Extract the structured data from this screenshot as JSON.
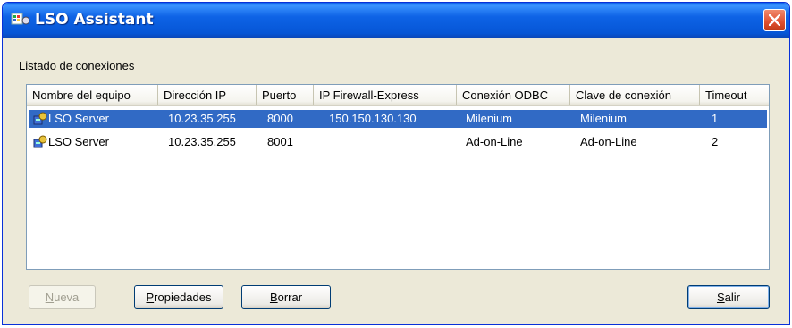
{
  "window": {
    "title": "LSO Assistant",
    "icon": "lso-app-icon",
    "close_icon": "close-icon"
  },
  "list_label": "Listado de conexiones",
  "columns": [
    "Nombre del equipo",
    "Dirección IP",
    "Puerto",
    "IP Firewall-Express",
    "Conexión ODBC",
    "Clave de conexión",
    "Timeout"
  ],
  "rows": [
    {
      "selected": true,
      "icon": "server-connection-icon",
      "cells": [
        "LSO Server",
        "10.23.35.255",
        "8000",
        "150.150.130.130",
        "Milenium",
        "Milenium",
        "1"
      ]
    },
    {
      "selected": false,
      "icon": "server-connection-icon",
      "cells": [
        "LSO Server",
        "10.23.35.255",
        "8001",
        "",
        "Ad-on-Line",
        "Ad-on-Line",
        "2"
      ]
    }
  ],
  "buttons": {
    "nueva": {
      "mnemonic": "N",
      "rest": "ueva",
      "enabled": false
    },
    "propiedades": {
      "mnemonic": "P",
      "rest": "ropiedades",
      "enabled": true
    },
    "borrar": {
      "mnemonic": "B",
      "rest": "orrar",
      "enabled": true
    },
    "salir": {
      "mnemonic": "S",
      "rest": "alir",
      "enabled": true
    }
  },
  "colors": {
    "selection": "#316ac5",
    "titlebar": "#0656d6",
    "window_bg": "#ece9d8"
  }
}
